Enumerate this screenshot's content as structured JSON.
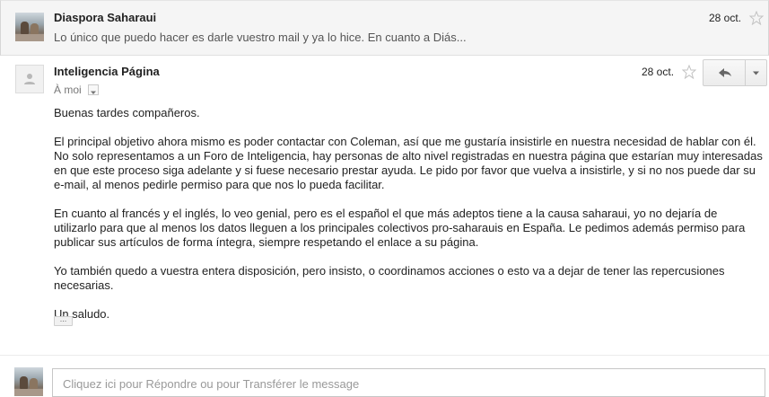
{
  "thread": {
    "collapsed": {
      "sender": "Diaspora Saharaui",
      "date": "28 oct.",
      "snippet": "Lo único que puedo hacer es darle vuestro mail y ya lo hice. En cuanto a Diás..."
    },
    "expanded": {
      "sender": "Inteligencia Página",
      "date": "28 oct.",
      "recipient": "À moi",
      "body": [
        "Buenas tardes compañeros.",
        "El principal objetivo ahora mismo es poder contactar con Coleman, así que me gustaría insistirle en nuestra  necesidad de hablar con él. No solo representamos a un Foro de Inteligencia, hay personas de alto nivel registradas en nuestra página que estarían muy interesadas en que este proceso siga adelante y si fuese necesario prestar ayuda. Le pido por favor que vuelva a insistirle, y si no nos puede dar su e-mail, al menos pedirle permiso para que nos lo pueda facilitar.",
        "En cuanto al francés y el inglés, lo veo genial, pero es el español el que más adeptos tiene a la causa saharaui, yo no dejaría de utilizarlo para que al menos los datos lleguen a los principales colectivos pro-saharauis en España. Le pedimos además permiso para publicar sus artículos de forma íntegra, siempre respetando el enlace a su página.",
        "Yo también quedo a vuestra entera disposición, pero insisto, o coordinamos acciones o esto va a dejar de tener las repercusiones necesarias.",
        "Un saludo."
      ],
      "trimmed_label": "..."
    },
    "reply_placeholder": "Cliquez ici pour Répondre ou pour Transférer le message"
  },
  "icons": {
    "star": "star-outline-icon",
    "reply": "reply-arrow-icon",
    "more": "dropdown-arrow-icon",
    "avatar_default": "person-silhouette-icon"
  },
  "colors": {
    "collapsed_bg": "#f5f5f5",
    "star_outline": "#c2c2c2",
    "reply_icon": "#666666"
  }
}
